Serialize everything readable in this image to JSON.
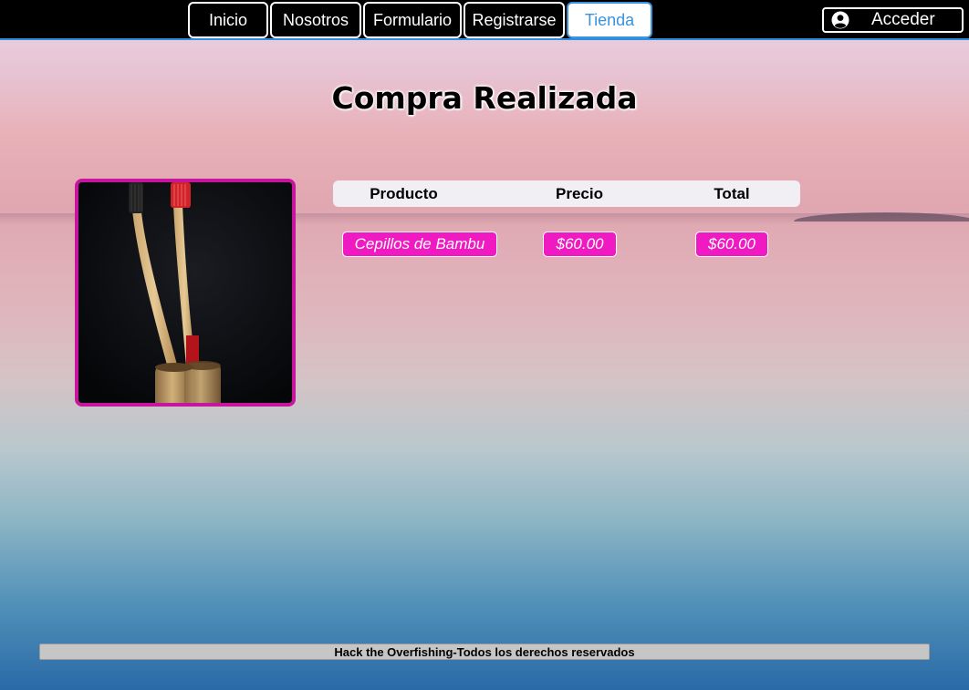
{
  "nav": {
    "tabs": [
      {
        "label": "Inicio",
        "active": false
      },
      {
        "label": "Nosotros",
        "active": false
      },
      {
        "label": "Formulario",
        "active": false
      },
      {
        "label": "Registrarse",
        "active": false
      },
      {
        "label": "Tienda",
        "active": true
      }
    ],
    "login_label": "Acceder",
    "login_icon": "user-circle-icon"
  },
  "page": {
    "title": "Compra Realizada"
  },
  "product_image": {
    "icon": "bamboo-toothbrushes-image"
  },
  "table": {
    "headers": [
      "Producto",
      "Precio",
      "Total"
    ],
    "rows": [
      [
        "Cepillos de Bambu",
        "$60.00",
        "$60.00"
      ]
    ]
  },
  "footer": {
    "brand": "Hack the Overfishing",
    "separator": "-",
    "rights": "Todos los derechos reservados"
  },
  "colors": {
    "accent_blue": "#3b93de",
    "magenta": "#ef1ac2",
    "frame_magenta": "#c7159f",
    "nav_background": "#000000"
  }
}
